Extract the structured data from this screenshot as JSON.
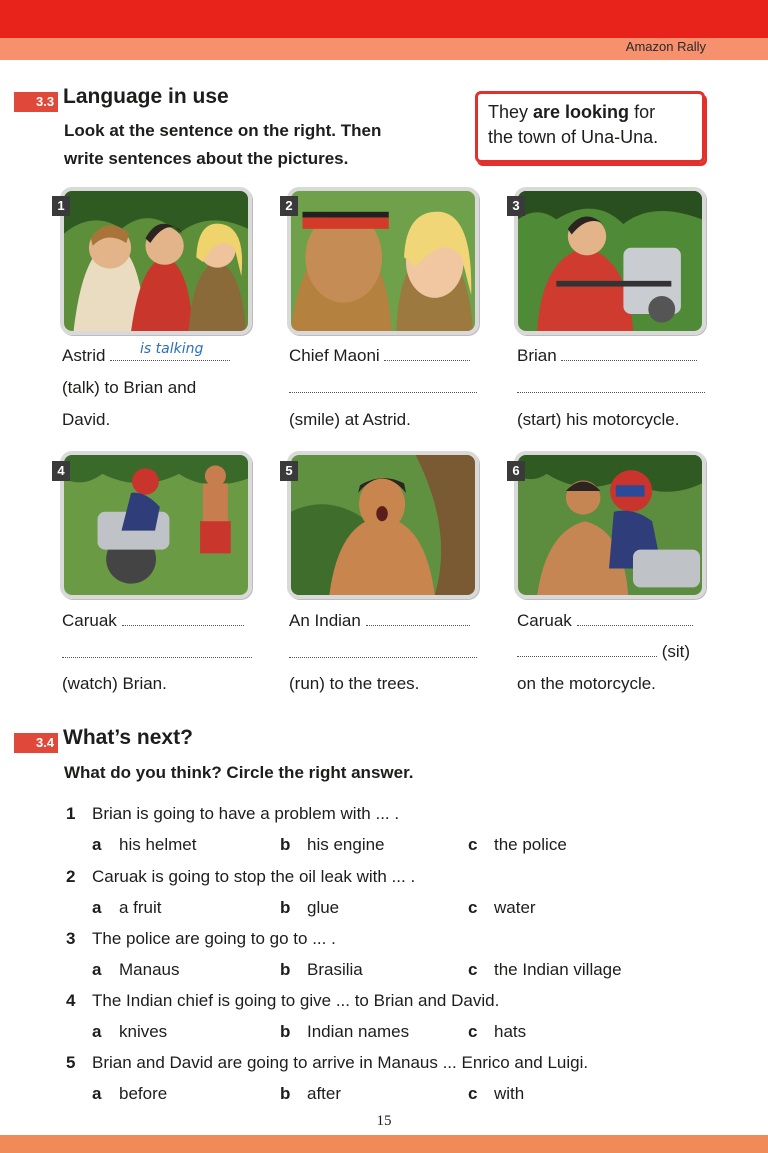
{
  "header": {
    "running_title": "Amazon Rally"
  },
  "section_3_3": {
    "number": "3.3",
    "title": "Language in use",
    "instruction_line1": "Look at the sentence on the right. Then",
    "instruction_line2": "write sentences about the pictures.",
    "example_pre": "They ",
    "example_bold": "are looking",
    "example_post": " for",
    "example_line2": "the town of Una-Una.",
    "items": [
      {
        "num": "1",
        "subject": "Astrid",
        "handwritten": "is talking",
        "line2": "(talk) to Brian and",
        "line3": "David."
      },
      {
        "num": "2",
        "subject": "Chief Maoni",
        "line3": "(smile) at Astrid."
      },
      {
        "num": "3",
        "subject": "Brian",
        "line3": "(start) his motorcycle."
      },
      {
        "num": "4",
        "subject": "Caruak",
        "line3": "(watch) Brian."
      },
      {
        "num": "5",
        "subject": "An Indian",
        "line3": "(run) to the trees."
      },
      {
        "num": "6",
        "subject": "Caruak",
        "line2_end": "(sit)",
        "line3": "on the motorcycle."
      }
    ]
  },
  "section_3_4": {
    "number": "3.4",
    "title": "What’s next?",
    "instruction": "What do you think? Circle the right answer.",
    "questions": [
      {
        "num": "1",
        "text": "Brian is going to have a problem with ... .",
        "a": "his helmet",
        "b": "his engine",
        "c": "the police"
      },
      {
        "num": "2",
        "text": "Caruak is going to stop the oil leak with ... .",
        "a": "a fruit",
        "b": "glue",
        "c": "water"
      },
      {
        "num": "3",
        "text": "The police are going to go to ... .",
        "a": "Manaus",
        "b": "Brasilia",
        "c": "the Indian village"
      },
      {
        "num": "4",
        "text": "The Indian chief is going to give ... to Brian and David.",
        "a": "knives",
        "b": "Indian names",
        "c": "hats"
      },
      {
        "num": "5",
        "text": "Brian and David are going to arrive in Manaus ... Enrico and Luigi.",
        "a": "before",
        "b": "after",
        "c": "with"
      }
    ],
    "option_labels": {
      "a": "a",
      "b": "b",
      "c": "c"
    }
  },
  "footer": {
    "page_number": "15"
  },
  "colors": {
    "accent_red": "#e8231b",
    "accent_orange": "#f6906d",
    "box_border": "#e3302a"
  }
}
